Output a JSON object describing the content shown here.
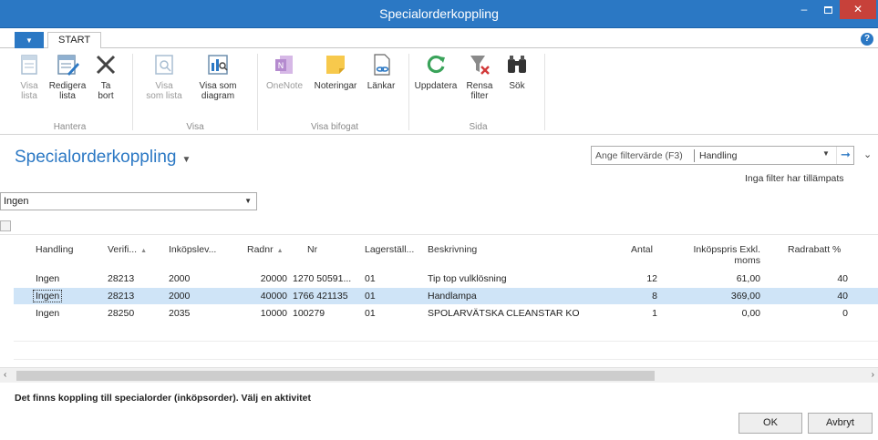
{
  "window": {
    "title": "Specialorderkoppling"
  },
  "ribbon": {
    "tab_start": "START",
    "groups": [
      {
        "label": "Hantera",
        "buttons": [
          {
            "label1": "Visa",
            "label2": "lista",
            "icon": "view-list-icon"
          },
          {
            "label1": "Redigera",
            "label2": "lista",
            "icon": "edit-list-icon"
          },
          {
            "label1": "Ta",
            "label2": "bort",
            "icon": "delete-icon"
          }
        ]
      },
      {
        "label": "Visa",
        "buttons": [
          {
            "label1": "Visa",
            "label2": "som lista",
            "icon": "show-as-list-icon"
          },
          {
            "label1": "Visa som",
            "label2": "diagram",
            "icon": "show-as-chart-icon"
          }
        ]
      },
      {
        "label": "Visa bifogat",
        "buttons": [
          {
            "label1": "OneNote",
            "label2": "",
            "icon": "onenote-icon"
          },
          {
            "label1": "Noteringar",
            "label2": "",
            "icon": "notes-icon"
          },
          {
            "label1": "Länkar",
            "label2": "",
            "icon": "links-icon"
          }
        ]
      },
      {
        "label": "Sida",
        "buttons": [
          {
            "label1": "Uppdatera",
            "label2": "",
            "icon": "refresh-icon"
          },
          {
            "label1": "Rensa",
            "label2": "filter",
            "icon": "clear-filter-icon"
          },
          {
            "label1": "Sök",
            "label2": "",
            "icon": "find-icon"
          }
        ]
      }
    ]
  },
  "page": {
    "title": "Specialorderkoppling",
    "filter_placeholder": "Ange filtervärde (F3)",
    "filter_field": "Handling",
    "no_filter_text": "Inga filter har tillämpats",
    "view_selected": "Ingen"
  },
  "table": {
    "headers": {
      "handling": "Handling",
      "verifi": "Verifi...",
      "inkopslev": "Inköpslev...",
      "radnr": "Radnr",
      "nr": "Nr",
      "lagerstall": "Lagerställ...",
      "beskrivning": "Beskrivning",
      "antal": "Antal",
      "inkopspris1": "Inköpspris Exkl.",
      "inkopspris2": "moms",
      "radrabatt": "Radrabatt %"
    },
    "rows": [
      {
        "handling": "Ingen",
        "verifi": "28213",
        "inkopslev": "2000",
        "radnr": "20000",
        "nr": "1270 50591...",
        "lagerstall": "01",
        "beskrivning": "Tip top vulklösning",
        "antal": "12",
        "inkopspris": "61,00",
        "radrabatt": "40"
      },
      {
        "handling": "Ingen",
        "verifi": "28213",
        "inkopslev": "2000",
        "radnr": "40000",
        "nr": "1766 421135",
        "lagerstall": "01",
        "beskrivning": "Handlampa",
        "antal": "8",
        "inkopspris": "369,00",
        "radrabatt": "40"
      },
      {
        "handling": "Ingen",
        "verifi": "28250",
        "inkopslev": "2035",
        "radnr": "10000",
        "nr": "100279",
        "lagerstall": "01",
        "beskrivning": "SPOLARVÄTSKA CLEANSTAR KO",
        "antal": "1",
        "inkopspris": "0,00",
        "radrabatt": "0"
      }
    ]
  },
  "status_message": "Det finns koppling till specialorder (inköpsorder). Välj en aktivitet",
  "buttons": {
    "ok": "OK",
    "cancel": "Avbryt"
  },
  "colors": {
    "accent": "#2b78c4",
    "selection": "#cfe4f7",
    "close": "#c7413a"
  }
}
